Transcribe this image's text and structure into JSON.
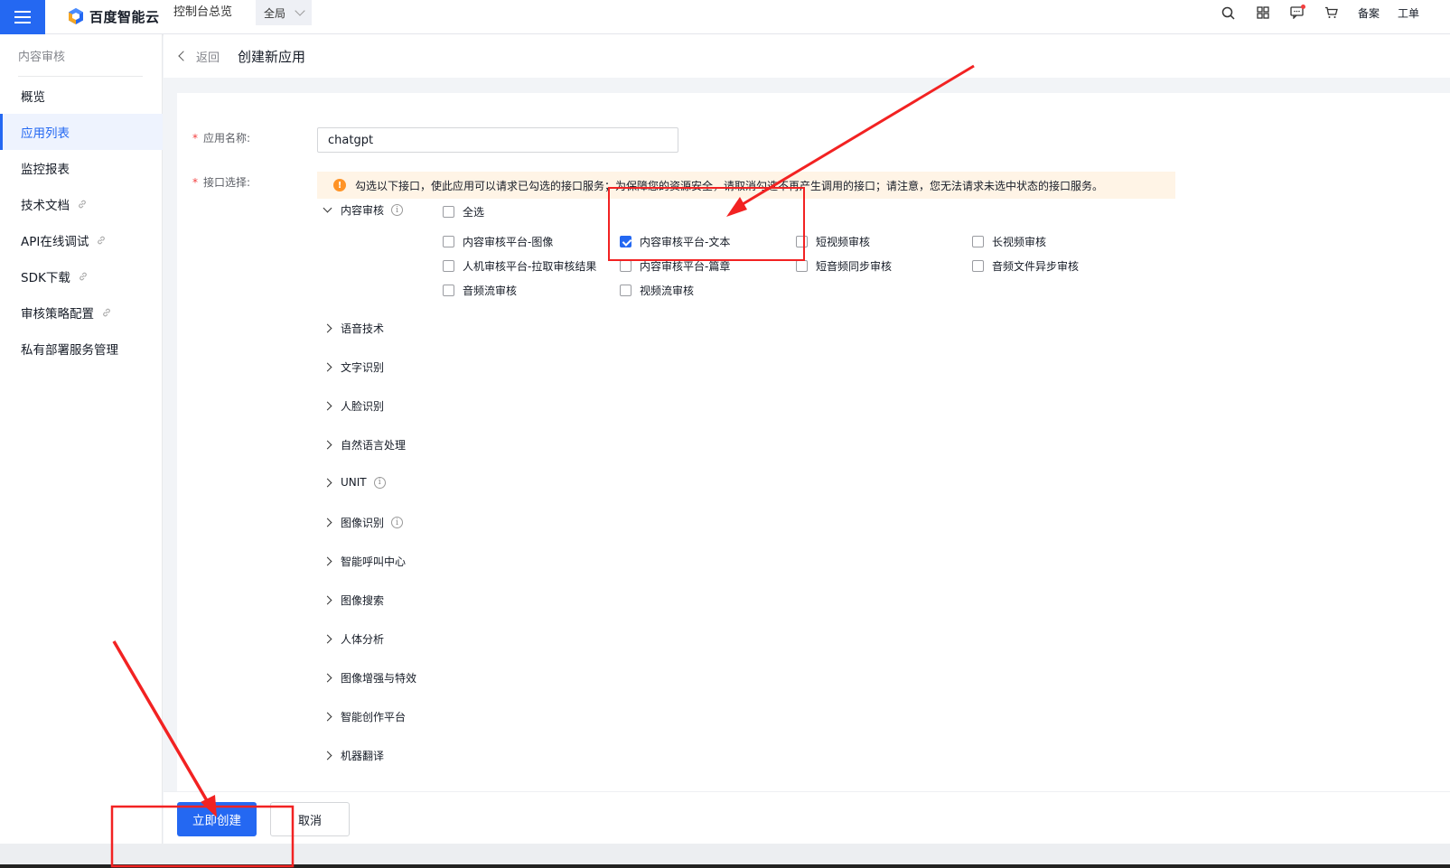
{
  "header": {
    "logo_text": "百度智能云",
    "nav_overview": "控制台总览",
    "region": "全局",
    "icons": [
      "search-icon",
      "apps-grid-icon",
      "message-icon",
      "cart-icon"
    ],
    "beian": "备案",
    "ticket": "工单"
  },
  "sidebar": {
    "title": "内容审核",
    "items": [
      {
        "label": "概览",
        "link": false
      },
      {
        "label": "应用列表",
        "link": false,
        "active": true
      },
      {
        "label": "监控报表",
        "link": false
      },
      {
        "label": "技术文档",
        "link": true
      },
      {
        "label": "API在线调试",
        "link": true
      },
      {
        "label": "SDK下载",
        "link": true
      },
      {
        "label": "审核策略配置",
        "link": true
      },
      {
        "label": "私有部署服务管理",
        "link": false
      }
    ]
  },
  "page": {
    "back": "返回",
    "title": "创建新应用"
  },
  "form": {
    "name_label": "应用名称:",
    "name_value": "chatgpt",
    "api_label": "接口选择:",
    "notice": "勾选以下接口，使此应用可以请求已勾选的接口服务；为保障您的资源安全，请取消勾选不再产生调用的接口；请注意，您无法请求未选中状态的接口服务。",
    "expanded_group": "内容审核",
    "select_all": "全选",
    "options": [
      {
        "label": "内容审核平台-图像",
        "checked": false
      },
      {
        "label": "内容审核平台-文本",
        "checked": true
      },
      {
        "label": "短视频审核",
        "checked": false
      },
      {
        "label": "长视频审核",
        "checked": false
      },
      {
        "label": "人机审核平台-拉取审核结果",
        "checked": false
      },
      {
        "label": "内容审核平台-篇章",
        "checked": false
      },
      {
        "label": "短音频同步审核",
        "checked": false
      },
      {
        "label": "音频文件异步审核",
        "checked": false
      },
      {
        "label": "音频流审核",
        "checked": false
      },
      {
        "label": "视频流审核",
        "checked": false
      }
    ],
    "collapsed_groups": [
      {
        "label": "语音技术",
        "info": false
      },
      {
        "label": "文字识别",
        "info": false
      },
      {
        "label": "人脸识别",
        "info": false
      },
      {
        "label": "自然语言处理",
        "info": false
      },
      {
        "label": "UNIT",
        "info": true
      },
      {
        "label": "图像识别",
        "info": true
      },
      {
        "label": "智能呼叫中心",
        "info": false
      },
      {
        "label": "图像搜索",
        "info": false
      },
      {
        "label": "人体分析",
        "info": false
      },
      {
        "label": "图像增强与特效",
        "info": false
      },
      {
        "label": "智能创作平台",
        "info": false
      },
      {
        "label": "机器翻译",
        "info": false
      }
    ]
  },
  "footer": {
    "create": "立即创建",
    "cancel": "取消"
  },
  "colors": {
    "primary": "#2468f2",
    "annotation": "#f22222",
    "notice_bg": "#fff4e6",
    "warn": "#ff9326"
  }
}
